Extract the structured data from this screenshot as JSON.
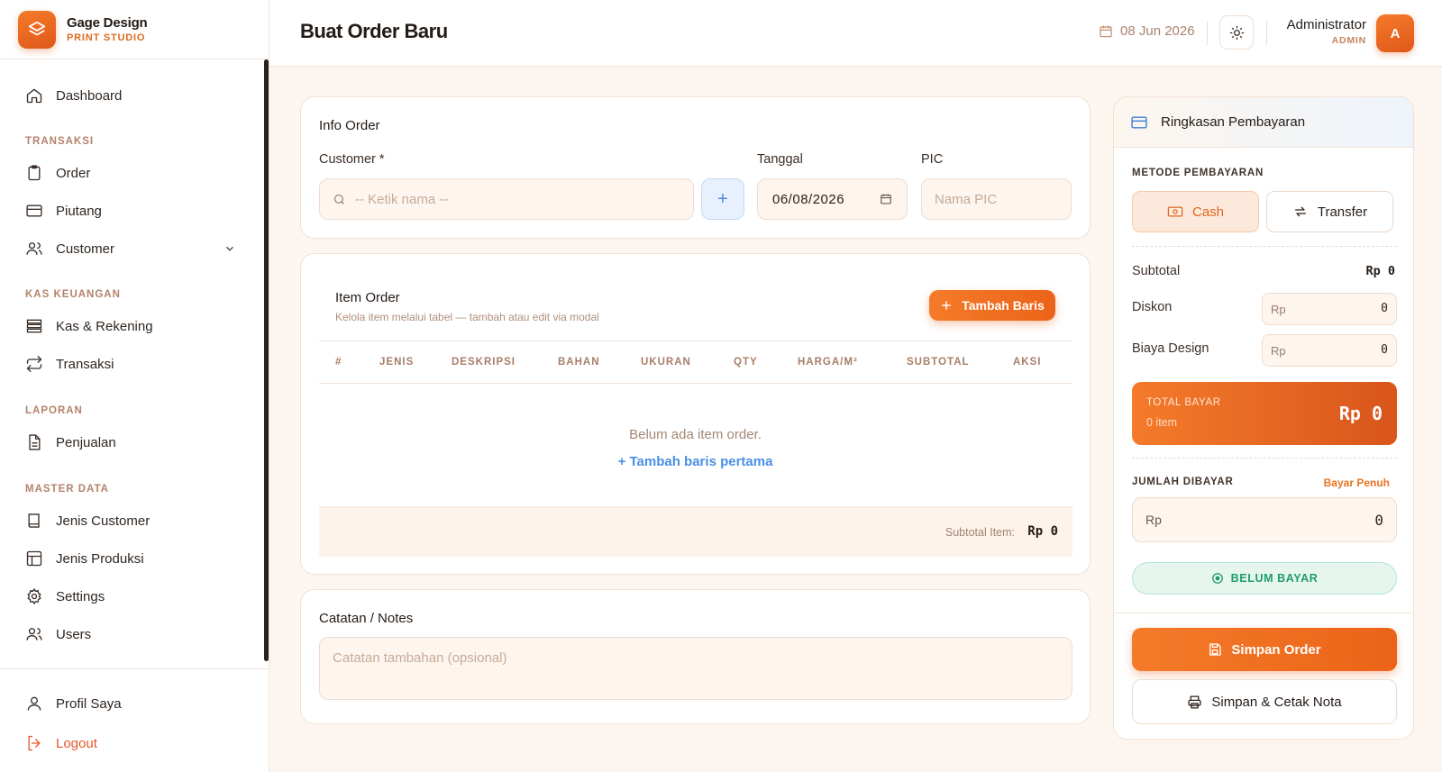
{
  "brand": {
    "name": "Gage Design",
    "subtitle": "PRINT STUDIO"
  },
  "sidebar": {
    "dashboard": "Dashboard",
    "section_transaksi": "TRANSAKSI",
    "order": "Order",
    "piutang": "Piutang",
    "customer": "Customer",
    "section_kas": "KAS KEUANGAN",
    "kas_rekening": "Kas & Rekening",
    "transaksi": "Transaksi",
    "section_laporan": "LAPORAN",
    "penjualan": "Penjualan",
    "section_master": "MASTER DATA",
    "jenis_customer": "Jenis Customer",
    "jenis_produksi": "Jenis Produksi",
    "settings": "Settings",
    "users": "Users",
    "profil": "Profil Saya",
    "logout": "Logout"
  },
  "header": {
    "title": "Buat Order Baru",
    "date": "08 Jun 2026",
    "user_name": "Administrator",
    "user_role": "ADMIN",
    "avatar_initial": "A"
  },
  "info_order": {
    "title": "Info Order",
    "customer_label": "Customer *",
    "customer_placeholder": "-- Ketik nama --",
    "add_symbol": "+",
    "tanggal_label": "Tanggal",
    "tanggal_value": "06/08/2026",
    "pic_label": "PIC",
    "pic_placeholder": "Nama PIC"
  },
  "item_order": {
    "title": "Item Order",
    "subtitle": "Kelola item melalui tabel — tambah atau edit via modal",
    "add_button": "Tambah Baris",
    "columns": [
      "#",
      "JENIS",
      "DESKRIPSI",
      "BAHAN",
      "UKURAN",
      "QTY",
      "HARGA/M²",
      "SUBTOTAL",
      "AKSI"
    ],
    "empty_text": "Belum ada item order.",
    "empty_link": "+ Tambah baris pertama",
    "subtotal_label": "Subtotal Item:",
    "subtotal_value": "Rp 0"
  },
  "notes": {
    "title": "Catatan / Notes",
    "placeholder": "Catatan tambahan (opsional)"
  },
  "payment": {
    "title": "Ringkasan Pembayaran",
    "method_label": "METODE PEMBAYARAN",
    "method_cash": "Cash",
    "method_transfer": "Transfer",
    "subtotal_label": "Subtotal",
    "subtotal_value": "Rp 0",
    "diskon_label": "Diskon",
    "diskon_prefix": "Rp",
    "diskon_value": "0",
    "biaya_label": "Biaya Design",
    "biaya_prefix": "Rp",
    "biaya_value": "0",
    "total_label": "TOTAL BAYAR",
    "total_items": "0 item",
    "total_value": "Rp 0",
    "jumlah_label": "JUMLAH DIBAYAR",
    "bayar_penuh": "Bayar Penuh",
    "jumlah_prefix": "Rp",
    "jumlah_value": "0",
    "status_badge": "BELUM BAYAR",
    "save_button": "Simpan Order",
    "print_button": "Simpan & Cetak Nota"
  },
  "colors": {
    "accent": "#ef6c1f",
    "link": "#4a8fe5",
    "success": "#1f9c6b",
    "danger": "#e8572b"
  }
}
